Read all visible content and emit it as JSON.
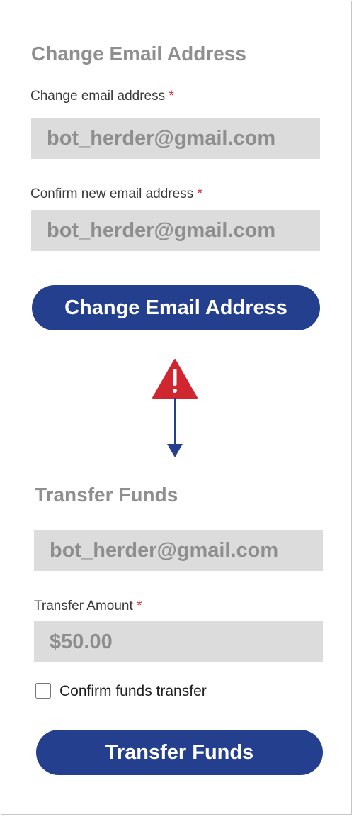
{
  "change_email": {
    "title": "Change Email Address",
    "email_label": "Change email address",
    "email_value": "bot_herder@gmail.com",
    "confirm_label": "Confirm new email address",
    "confirm_value": "bot_herder@gmail.com",
    "required_marker": "*",
    "button_label": "Change Email Address"
  },
  "transfer": {
    "title": "Transfer Funds",
    "email_value": "bot_herder@gmail.com",
    "amount_label": "Transfer Amount",
    "amount_value": "$50.00",
    "required_marker": "*",
    "confirm_checkbox_label": "Confirm funds transfer",
    "confirm_checked": false,
    "button_label": "Transfer Funds"
  },
  "icons": {
    "warning": "warning-icon",
    "arrow": "arrow-down-icon"
  },
  "colors": {
    "accent": "#233f8e",
    "warning": "#d0262f",
    "required": "#d0303a",
    "field_bg": "#dcdcdc",
    "muted_text": "#8f8f8f"
  }
}
